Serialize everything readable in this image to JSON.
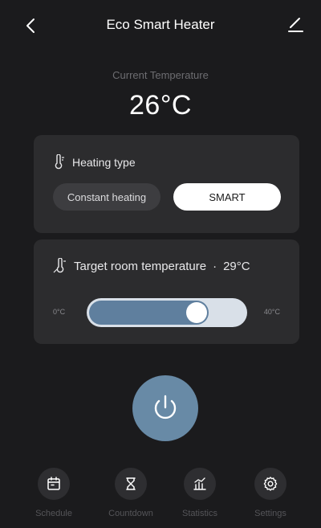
{
  "header": {
    "title": "Eco Smart Heater",
    "back_icon": "chevron-left-icon",
    "edit_icon": "pencil-icon"
  },
  "current": {
    "label": "Current Temperature",
    "value": "26°C"
  },
  "heating": {
    "title": "Heating type",
    "icon": "thermometer-icon",
    "options": [
      "Constant heating",
      "SMART"
    ],
    "selected": "SMART"
  },
  "target": {
    "title": "Target room temperature",
    "separator": "·",
    "value": "29°C",
    "icon": "thermometer-icon",
    "min_label": "0°C",
    "max_label": "40°C",
    "slider_fraction": 0.725
  },
  "power": {
    "icon": "power-icon"
  },
  "nav": {
    "items": [
      {
        "label": "Schedule",
        "icon": "calendar-icon"
      },
      {
        "label": "Countdown",
        "icon": "hourglass-icon"
      },
      {
        "label": "Statistics",
        "icon": "chart-icon"
      },
      {
        "label": "Settings",
        "icon": "gear-icon"
      }
    ]
  },
  "colors": {
    "background": "#1b1b1d",
    "card": "#2c2c2e",
    "accent": "#688aa6",
    "slider_fill": "#5f7f9e",
    "slider_track": "#d9e0e8"
  }
}
